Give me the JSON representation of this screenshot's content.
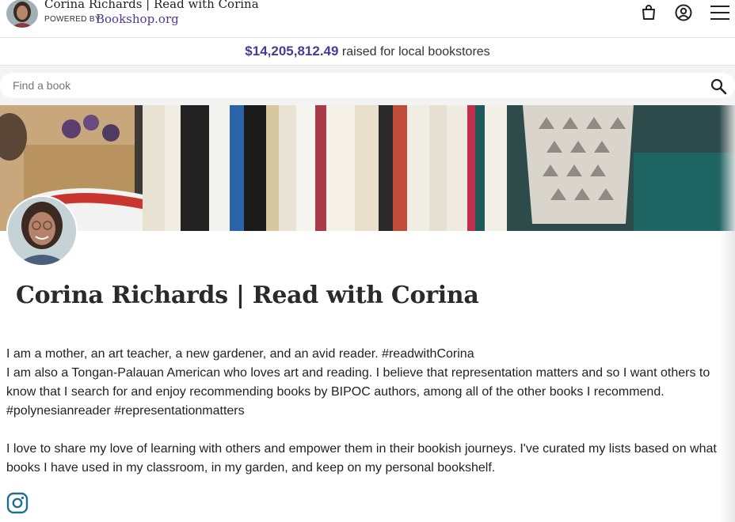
{
  "header": {
    "site_title": "Corina Richards | Read with Corina",
    "powered_by": "POWERED BY",
    "brand": "Bookshop.org",
    "icons": [
      "shopping-bag-icon",
      "account-icon",
      "menu-icon"
    ]
  },
  "raised_banner": {
    "amount": "$14,205,812.49",
    "text": "raised for local bookstores"
  },
  "search": {
    "placeholder": "Find a book",
    "value": ""
  },
  "profile": {
    "name": "Corina Richards | Read with Corina",
    "bio": [
      "I am a mother, an art teacher, a new gardener, and an avid reader. #readwithCorina",
      "I am also a Tongan-Palauan American who loves art and reading. I believe that representation matters and so I want others to know that I search for and enjoy recommending books by BIPOC authors, among all of the other books I recommend. #polynesianreader #representationmatters",
      "",
      "I love to share my love of learning with others and empower them in their bookish journeys. I've curated my lists based on what books I have used in my classroom, in my garden, and keep on my personal bookshelf."
    ],
    "social_icon": "instagram-icon"
  },
  "colors": {
    "brand_purple": "#4b3a93",
    "text": "#222222",
    "border": "#e2e2e2"
  }
}
